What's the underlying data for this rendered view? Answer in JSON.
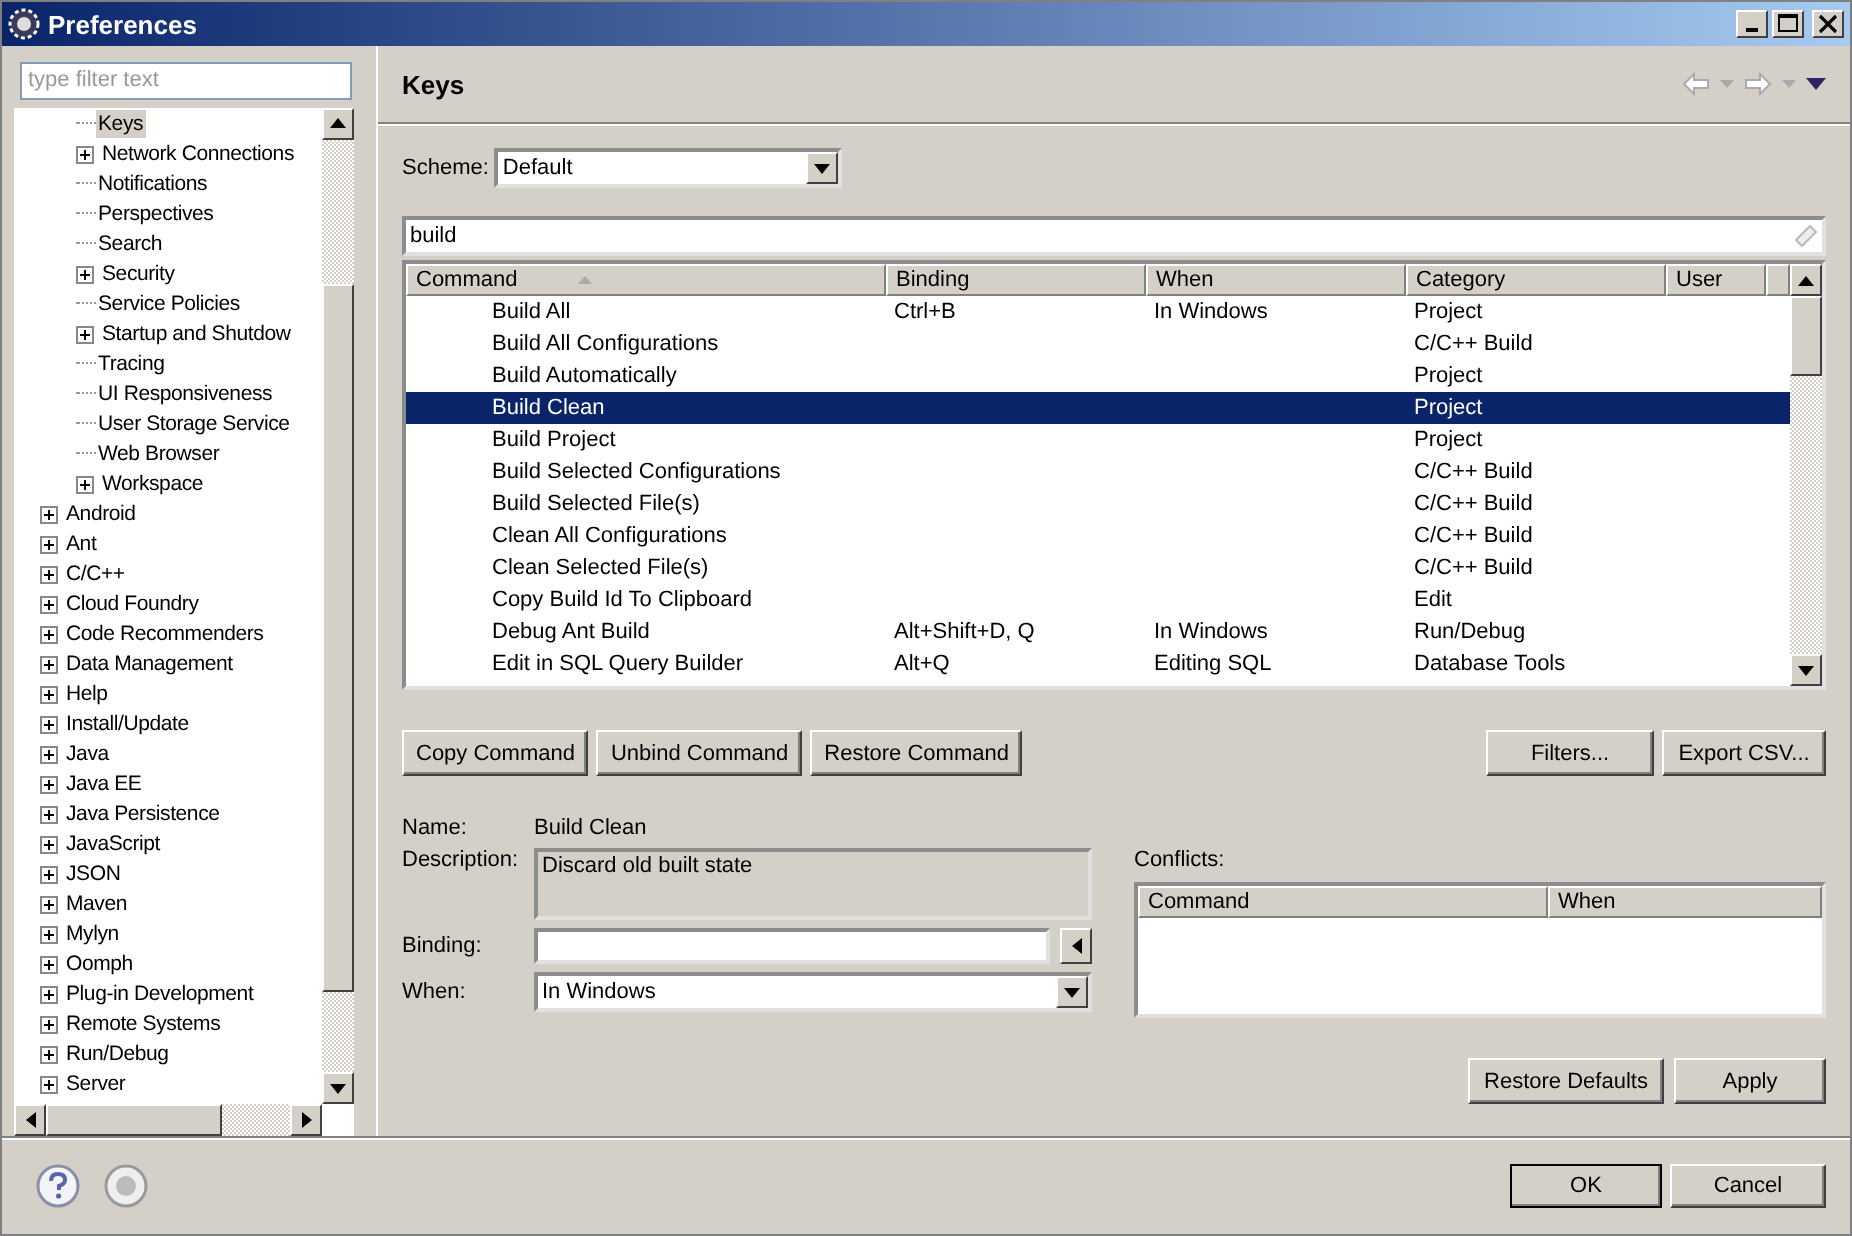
{
  "window": {
    "title": "Preferences"
  },
  "filter": {
    "placeholder": "type filter text"
  },
  "tree": {
    "items": [
      {
        "children": [
          {
            "label": "Keys",
            "kind": "leaf",
            "selected": true
          },
          {
            "label": "Network Connections",
            "kind": "folder",
            "selected": false
          },
          {
            "label": "Notifications",
            "kind": "leaf",
            "selected": false
          },
          {
            "label": "Perspectives",
            "kind": "leaf",
            "selected": false
          },
          {
            "label": "Search",
            "kind": "leaf",
            "selected": false
          },
          {
            "label": "Security",
            "kind": "folder",
            "selected": false
          },
          {
            "label": "Service Policies",
            "kind": "leaf",
            "selected": false
          },
          {
            "label": "Startup and Shutdow",
            "kind": "folder",
            "selected": false
          },
          {
            "label": "Tracing",
            "kind": "leaf",
            "selected": false
          },
          {
            "label": "UI Responsiveness",
            "kind": "leaf",
            "selected": false
          },
          {
            "label": "User Storage Service",
            "kind": "leaf",
            "selected": false
          },
          {
            "label": "Web Browser",
            "kind": "leaf",
            "selected": false
          },
          {
            "label": "Workspace",
            "kind": "folder",
            "selected": false
          }
        ]
      },
      {
        "label": "Android",
        "kind": "folder",
        "selected": false
      },
      {
        "label": "Ant",
        "kind": "folder",
        "selected": false
      },
      {
        "label": "C/C++",
        "kind": "folder",
        "selected": false
      },
      {
        "label": "Cloud Foundry",
        "kind": "folder",
        "selected": false
      },
      {
        "label": "Code Recommenders",
        "kind": "folder",
        "selected": false
      },
      {
        "label": "Data Management",
        "kind": "folder",
        "selected": false
      },
      {
        "label": "Help",
        "kind": "folder",
        "selected": false
      },
      {
        "label": "Install/Update",
        "kind": "folder",
        "selected": false
      },
      {
        "label": "Java",
        "kind": "folder",
        "selected": false
      },
      {
        "label": "Java EE",
        "kind": "folder",
        "selected": false
      },
      {
        "label": "Java Persistence",
        "kind": "folder",
        "selected": false
      },
      {
        "label": "JavaScript",
        "kind": "folder",
        "selected": false
      },
      {
        "label": "JSON",
        "kind": "folder",
        "selected": false
      },
      {
        "label": "Maven",
        "kind": "folder",
        "selected": false
      },
      {
        "label": "Mylyn",
        "kind": "folder",
        "selected": false
      },
      {
        "label": "Oomph",
        "kind": "folder",
        "selected": false
      },
      {
        "label": "Plug-in Development",
        "kind": "folder",
        "selected": false
      },
      {
        "label": "Remote Systems",
        "kind": "folder",
        "selected": false
      },
      {
        "label": "Run/Debug",
        "kind": "folder",
        "selected": false
      },
      {
        "label": "Server",
        "kind": "folder",
        "selected": false
      }
    ]
  },
  "page": {
    "title": "Keys",
    "scheme": {
      "label": "Scheme:",
      "value": "Default"
    },
    "search": {
      "value": "build"
    },
    "table": {
      "columns": [
        "Command",
        "Binding",
        "When",
        "Category",
        "User"
      ],
      "rows": [
        {
          "command": "Build All",
          "binding": "Ctrl+B",
          "when": "In Windows",
          "category": "Project",
          "selected": false
        },
        {
          "command": "Build All Configurations",
          "binding": "",
          "when": "",
          "category": "C/C++ Build",
          "selected": false
        },
        {
          "command": "Build Automatically",
          "binding": "",
          "when": "",
          "category": "Project",
          "selected": false
        },
        {
          "command": "Build Clean",
          "binding": "",
          "when": "",
          "category": "Project",
          "selected": true
        },
        {
          "command": "Build Project",
          "binding": "",
          "when": "",
          "category": "Project",
          "selected": false
        },
        {
          "command": "Build Selected Configurations",
          "binding": "",
          "when": "",
          "category": "C/C++ Build",
          "selected": false
        },
        {
          "command": "Build Selected File(s)",
          "binding": "",
          "when": "",
          "category": "C/C++ Build",
          "selected": false
        },
        {
          "command": "Clean All Configurations",
          "binding": "",
          "when": "",
          "category": "C/C++ Build",
          "selected": false
        },
        {
          "command": "Clean Selected File(s)",
          "binding": "",
          "when": "",
          "category": "C/C++ Build",
          "selected": false
        },
        {
          "command": "Copy Build Id To Clipboard",
          "binding": "",
          "when": "",
          "category": "Edit",
          "selected": false
        },
        {
          "command": "Debug Ant Build",
          "binding": "Alt+Shift+D, Q",
          "when": "In Windows",
          "category": "Run/Debug",
          "selected": false
        },
        {
          "command": "Edit in SQL Query Builder",
          "binding": "Alt+Q",
          "when": "Editing SQL",
          "category": "Database Tools",
          "selected": false
        }
      ]
    },
    "left_buttons": [
      "Copy Command",
      "Unbind Command",
      "Restore Command"
    ],
    "right_buttons": [
      "Filters...",
      "Export CSV..."
    ],
    "details": {
      "name_label": "Name:",
      "name": "Build Clean",
      "description_label": "Description:",
      "description": "Discard old built state",
      "binding_label": "Binding:",
      "when_label": "When:",
      "when": "In Windows"
    },
    "conflicts": {
      "label": "Conflicts:",
      "columns": [
        "Command",
        "When"
      ]
    },
    "page_buttons": [
      "Restore Defaults",
      "Apply"
    ]
  },
  "dialog_buttons": [
    "OK",
    "Cancel"
  ]
}
